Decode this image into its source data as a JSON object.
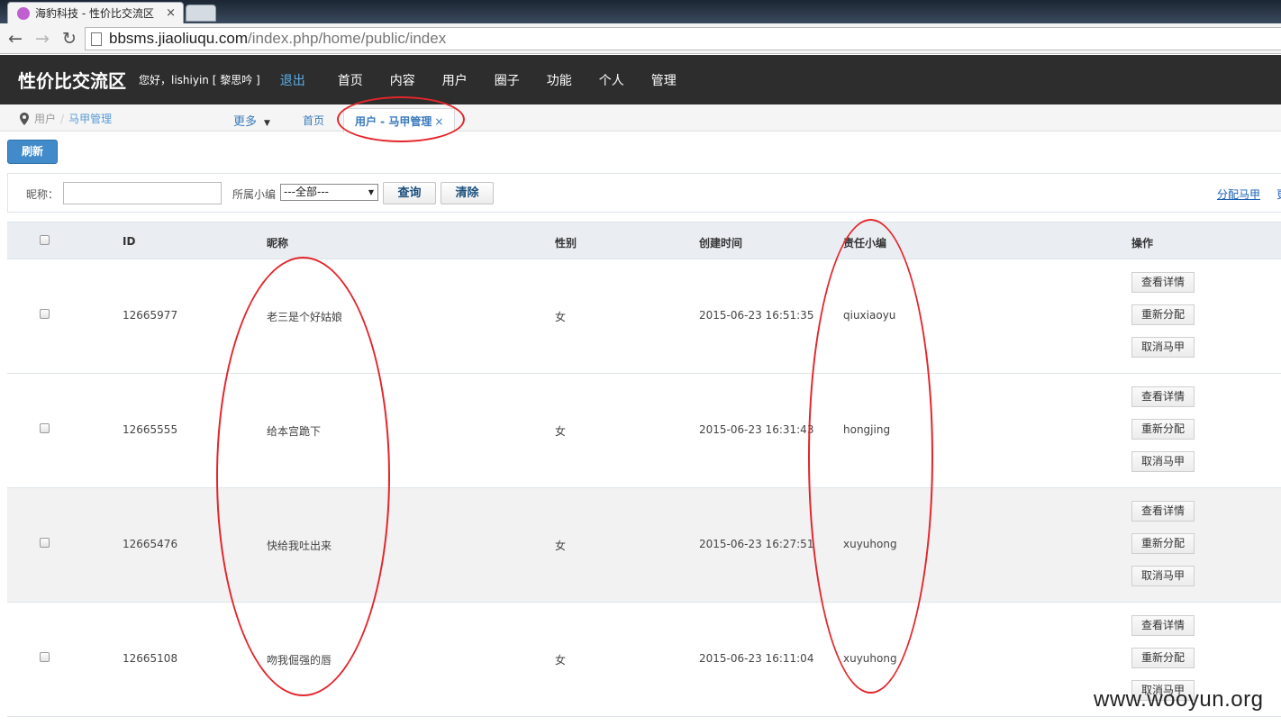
{
  "browser": {
    "tab_title": "海豹科技 - 性价比交流区",
    "tab_close": "×",
    "url_host": "bbsms.jiaoliuqu.com",
    "url_path": "/index.php/home/public/index"
  },
  "header": {
    "site_title": "性价比交流区",
    "greeting": "您好，lishiyin [ 黎思吟 ]",
    "logout": "退出",
    "nav": [
      "首页",
      "内容",
      "用户",
      "圈子",
      "功能",
      "个人",
      "管理"
    ]
  },
  "breadcrumb": {
    "root": "用户",
    "separator": "/",
    "current": "马甲管理"
  },
  "page_tabs": {
    "more": "更多",
    "home": "首页",
    "active": "用户 - 马甲管理",
    "active_close": "×"
  },
  "toolbar": {
    "refresh": "刷新"
  },
  "search": {
    "nickname_label": "昵称：",
    "nickname_value": "",
    "editor_label": "所属小编",
    "editor_selected": "---全部---",
    "query_button": "查询",
    "clear_button": "清除",
    "assign_link": "分配马甲",
    "cut_link": "更"
  },
  "table": {
    "headers": {
      "id": "ID",
      "nickname": "昵称",
      "gender": "性别",
      "created": "创建时间",
      "editor": "责任小编",
      "actions": "操作"
    },
    "rows": [
      {
        "id": "12665977",
        "nickname": "老三是个好姑娘",
        "gender": "女",
        "created": "2015-06-23 16:51:35",
        "editor": "qiuxiaoyu"
      },
      {
        "id": "12665555",
        "nickname": "给本宫跪下",
        "gender": "女",
        "created": "2015-06-23 16:31:43",
        "editor": "hongjing"
      },
      {
        "id": "12665476",
        "nickname": "快给我吐出来",
        "gender": "女",
        "created": "2015-06-23 16:27:51",
        "editor": "xuyuhong"
      },
      {
        "id": "12665108",
        "nickname": "吻我倔强的唇",
        "gender": "女",
        "created": "2015-06-23 16:11:04",
        "editor": "xuyuhong"
      }
    ],
    "action_labels": {
      "view": "查看详情",
      "reassign": "重新分配",
      "cancel": "取消马甲"
    }
  },
  "watermark": "www.wooyun.org",
  "colors": {
    "header_bg": "#2d2d2d",
    "accent_blue": "#428bca",
    "annotation_red": "#e4252b"
  }
}
